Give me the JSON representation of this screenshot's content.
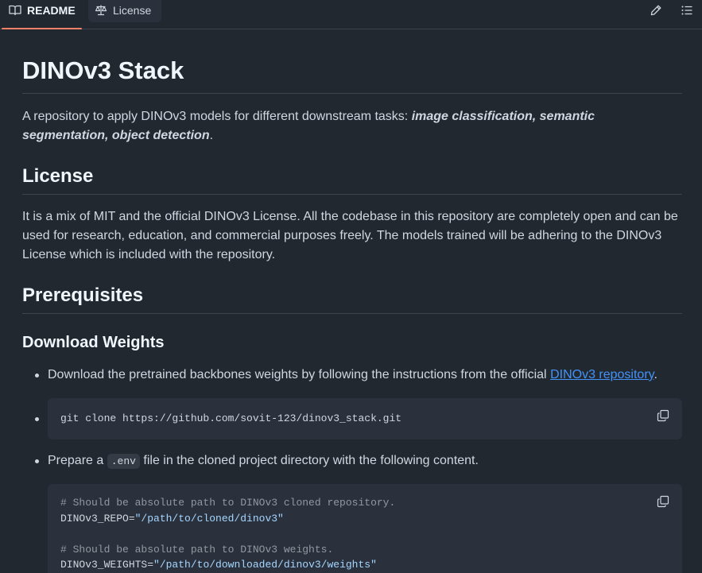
{
  "tabs": [
    {
      "label": "README",
      "icon": "book-icon",
      "active": true
    },
    {
      "label": "License",
      "icon": "scale-icon",
      "active": false
    }
  ],
  "toolbar": {
    "edit_icon": "pencil-icon",
    "outline_icon": "list-icon"
  },
  "article": {
    "title": "DINOv3 Stack",
    "intro_text": "A repository to apply DINOv3 models for different downstream tasks: ",
    "intro_em": "image classification, semantic segmentation, object detection",
    "intro_end": ".",
    "license_heading": "License",
    "license_text": "It is a mix of MIT and the official DINOv3 License. All the codebase in this repository are completely open and can be used for research, education, and commercial purposes freely. The models trained will be adhering to the DINOv3 License which is included with the repository.",
    "prereq_heading": "Prerequisites",
    "download_heading": "Download Weights",
    "bullet1_text": "Download the pretrained backbones weights by following the instructions from the official ",
    "bullet1_link": "DINOv3 repository",
    "bullet1_end": ".",
    "clone_cmd": "git clone https://github.com/sovit-123/dinov3_stack.git",
    "bullet3_pre": "Prepare a ",
    "bullet3_code": ".env",
    "bullet3_post": " file in the cloned project directory with the following content.",
    "env_comment1": "# Should be absolute path to DINOv3 cloned repository.",
    "env_key1": "DINOv3_REPO=",
    "env_val1": "\"/path/to/cloned/dinov3\"",
    "env_comment2": "# Should be absolute path to DINOv3 weights.",
    "env_key2": "DINOv3_WEIGHTS=",
    "env_val2": "\"/path/to/downloaded/dinov3/weights\""
  },
  "colors": {
    "background": "#212830",
    "accent_tab": "#f78166",
    "link": "#4493f8",
    "code_bg": "#2a313c",
    "string": "#a5d6ff"
  }
}
